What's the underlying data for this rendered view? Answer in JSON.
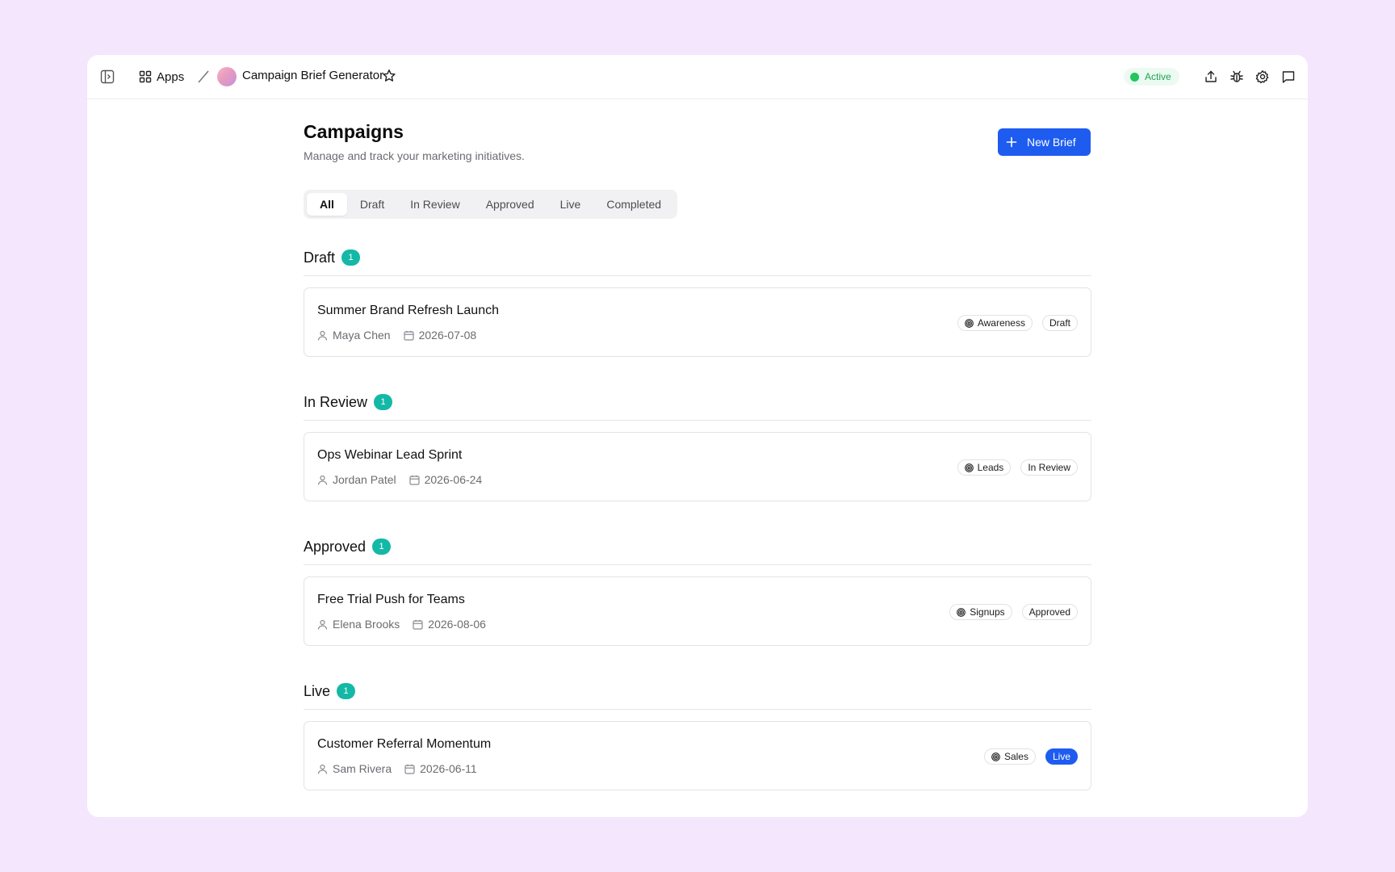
{
  "topbar": {
    "apps_label": "Apps",
    "app_title": "Campaign Brief Generator",
    "status_label": "Active"
  },
  "header": {
    "title": "Campaigns",
    "subtitle": "Manage and track your marketing initiatives.",
    "new_button_label": "New Brief"
  },
  "tabs": [
    {
      "label": "All",
      "active": true
    },
    {
      "label": "Draft",
      "active": false
    },
    {
      "label": "In Review",
      "active": false
    },
    {
      "label": "Approved",
      "active": false
    },
    {
      "label": "Live",
      "active": false
    },
    {
      "label": "Completed",
      "active": false
    }
  ],
  "sections": [
    {
      "title": "Draft",
      "count": "1",
      "campaign": {
        "title": "Summer Brand Refresh Launch",
        "owner": "Maya Chen",
        "date": "2026-07-08",
        "goal": "Awareness",
        "status": "Draft"
      }
    },
    {
      "title": "In Review",
      "count": "1",
      "campaign": {
        "title": "Ops Webinar Lead Sprint",
        "owner": "Jordan Patel",
        "date": "2026-06-24",
        "goal": "Leads",
        "status": "In Review"
      }
    },
    {
      "title": "Approved",
      "count": "1",
      "campaign": {
        "title": "Free Trial Push for Teams",
        "owner": "Elena Brooks",
        "date": "2026-08-06",
        "goal": "Signups",
        "status": "Approved"
      }
    },
    {
      "title": "Live",
      "count": "1",
      "campaign": {
        "title": "Customer Referral Momentum",
        "owner": "Sam Rivera",
        "date": "2026-06-11",
        "goal": "Sales",
        "status": "Live"
      }
    }
  ],
  "colors": {
    "background": "#f3e6fd",
    "accent": "#1e5cf0",
    "count_badge": "#14b8a6",
    "active_status": "#22c55e"
  }
}
